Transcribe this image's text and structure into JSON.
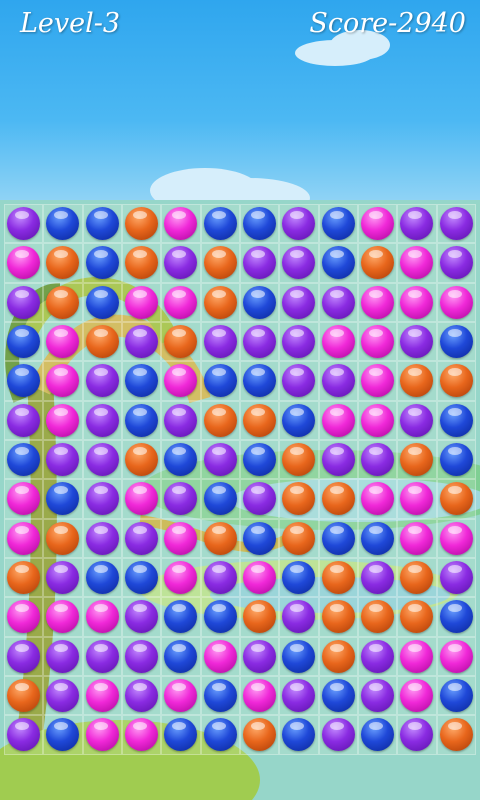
{
  "hud": {
    "level_text": "Level-3",
    "score_text": "Score-2940"
  },
  "colors": {
    "purple": "#8a2be2",
    "blue": "#1f48d8",
    "orange": "#e8661c",
    "pink": "#f028d8"
  },
  "board": {
    "rows": [
      [
        "purple",
        "blue",
        "blue",
        "orange",
        "pink",
        "blue",
        "blue",
        "purple",
        "blue",
        "pink",
        "purple",
        "purple"
      ],
      [
        "pink",
        "orange",
        "blue",
        "orange",
        "purple",
        "orange",
        "purple",
        "purple",
        "blue",
        "orange",
        "pink",
        "purple"
      ],
      [
        "purple",
        "orange",
        "blue",
        "pink",
        "pink",
        "orange",
        "blue",
        "purple",
        "purple",
        "pink",
        "pink",
        "pink"
      ],
      [
        "blue",
        "pink",
        "orange",
        "purple",
        "orange",
        "purple",
        "purple",
        "purple",
        "pink",
        "pink",
        "purple",
        "blue"
      ],
      [
        "blue",
        "pink",
        "purple",
        "blue",
        "pink",
        "blue",
        "blue",
        "purple",
        "purple",
        "pink",
        "orange",
        "orange"
      ],
      [
        "purple",
        "pink",
        "purple",
        "blue",
        "purple",
        "orange",
        "orange",
        "blue",
        "pink",
        "pink",
        "purple",
        "blue"
      ],
      [
        "blue",
        "purple",
        "purple",
        "orange",
        "blue",
        "purple",
        "blue",
        "orange",
        "purple",
        "purple",
        "orange",
        "blue"
      ],
      [
        "pink",
        "blue",
        "purple",
        "pink",
        "purple",
        "blue",
        "purple",
        "orange",
        "orange",
        "pink",
        "pink",
        "orange"
      ],
      [
        "pink",
        "orange",
        "purple",
        "purple",
        "pink",
        "orange",
        "blue",
        "orange",
        "blue",
        "blue",
        "pink",
        "pink"
      ],
      [
        "orange",
        "purple",
        "blue",
        "blue",
        "pink",
        "purple",
        "pink",
        "blue",
        "orange",
        "purple",
        "orange",
        "purple"
      ],
      [
        "pink",
        "pink",
        "pink",
        "purple",
        "blue",
        "blue",
        "orange",
        "purple",
        "orange",
        "orange",
        "orange",
        "blue"
      ],
      [
        "purple",
        "purple",
        "purple",
        "purple",
        "blue",
        "pink",
        "purple",
        "blue",
        "orange",
        "purple",
        "pink",
        "pink"
      ],
      [
        "orange",
        "purple",
        "pink",
        "purple",
        "pink",
        "blue",
        "pink",
        "purple",
        "blue",
        "purple",
        "pink",
        "blue"
      ],
      [
        "purple",
        "blue",
        "pink",
        "pink",
        "blue",
        "blue",
        "orange",
        "blue",
        "purple",
        "blue",
        "purple",
        "orange"
      ]
    ]
  }
}
